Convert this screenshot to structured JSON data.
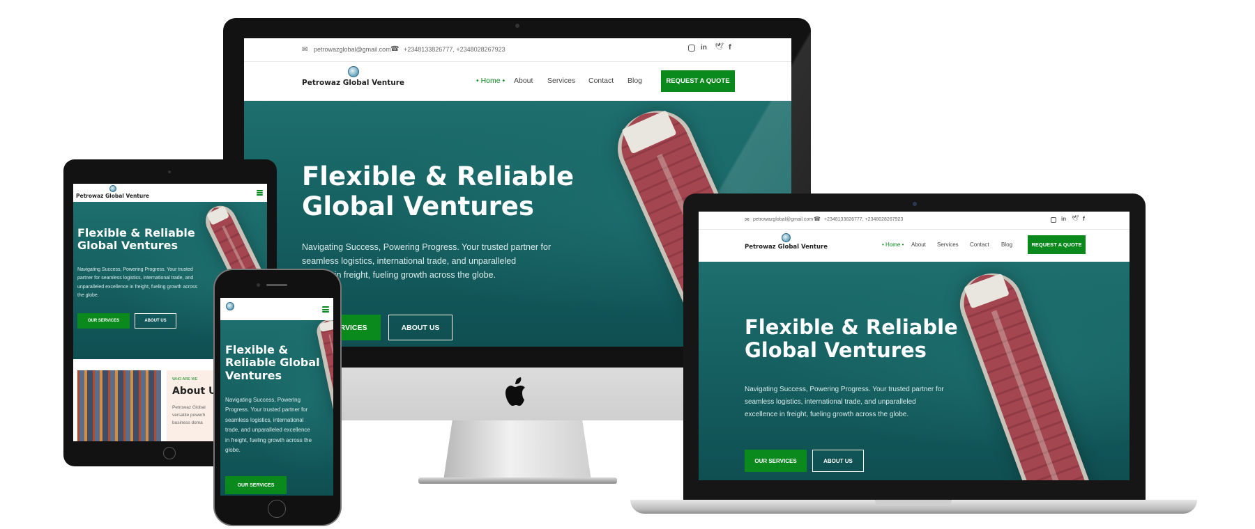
{
  "site": {
    "email": "petrowazglobal@gmail.com",
    "phone": "+2348133826777, +2348028267923",
    "logo_text": "Petrowaz Global Venture",
    "nav": [
      {
        "label": "Home",
        "active": true
      },
      {
        "label": "About",
        "active": false
      },
      {
        "label": "Services",
        "active": false
      },
      {
        "label": "Contact",
        "active": false
      },
      {
        "label": "Blog",
        "active": false
      }
    ],
    "quote_button": "REQUEST A QUOTE",
    "hero_title_line1": "Flexible & Reliable",
    "hero_title_line2": "Global Ventures",
    "hero_text": "Navigating Success, Powering Progress. Your trusted partner for seamless logistics, international trade, and unparalleled excellence in freight, fueling growth across the globe.",
    "btn_services": "OUR SERVICES",
    "btn_about": "ABOUT US",
    "imac_btn_services_partial": "RVICES",
    "imac_text_line1": "Navigating Success, Powering Progress. Your trusted partner for",
    "imac_text_line2": "seamless logistics, international trade, and unparalleled",
    "imac_text_line3_partial": "ce in freight, fueling growth across the globe.",
    "lap_text_line1": "Navigating Success, Powering Progress. Your trusted partner for",
    "lap_text_line2": "seamless logistics, international trade, and unparalleled",
    "lap_text_line3": "excellence in freight, fueling growth across the globe.",
    "tab_title_line1": "Flexible & Reliable",
    "tab_title_line2": "Global Ventures",
    "tab_text_lines": [
      "Navigating Success, Powering Progress. Your trusted",
      "partner for seamless logistics, international trade, and",
      "unparalleled excellence in freight, fueling growth across",
      "the globe."
    ],
    "ph_title_lines": [
      "Flexible &",
      "Reliable Global",
      "Ventures"
    ],
    "ph_text_lines": [
      "Navigating Success, Powering",
      "Progress. Your trusted partner for",
      "seamless logistics, international",
      "trade, and unparalleled excellence",
      "in freight, fueling growth across the",
      "globe."
    ],
    "about_eyebrow": "WHO ARE WE",
    "about_title_partial": "About U",
    "about_text_lines": [
      "Petrowaz Global",
      "versatile powerh",
      "business doma"
    ]
  },
  "icons": {
    "email": "envelope-icon",
    "phone": "phone-icon",
    "socials": [
      "instagram-icon",
      "linkedin-icon",
      "twitter-icon",
      "facebook-icon"
    ],
    "menu": "hamburger-icon",
    "device_brand": "apple-logo-icon"
  },
  "colors": {
    "brand_green": "#0a8a1c",
    "hero_teal": "#166061",
    "ship_red": "#a34650"
  }
}
